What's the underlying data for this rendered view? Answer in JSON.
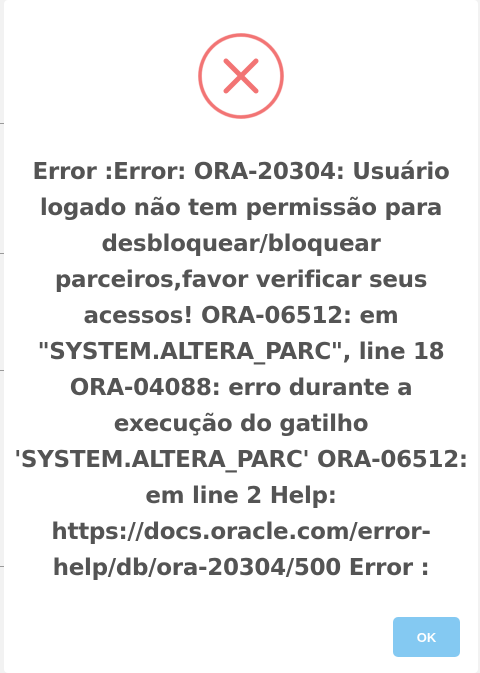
{
  "dialog": {
    "icon": "error-x-icon",
    "icon_color": "#f27474",
    "message": "Error :Error: ORA-20304: Usuário logado não tem permissão para desbloquear/bloquear parceiros,favor verificar seus acessos! ORA-06512: em \"SYSTEM.ALTERA_PARC\", line 18 ORA-04088: erro durante a execução do gatilho 'SYSTEM.ALTERA_PARC' ORA-06512: em line 2 Help: https://docs.oracle.com/error-help/db/ora-20304/500 Error :",
    "message_color": "#545454",
    "ok_label": "OK",
    "ok_color": "#84c9f2"
  }
}
